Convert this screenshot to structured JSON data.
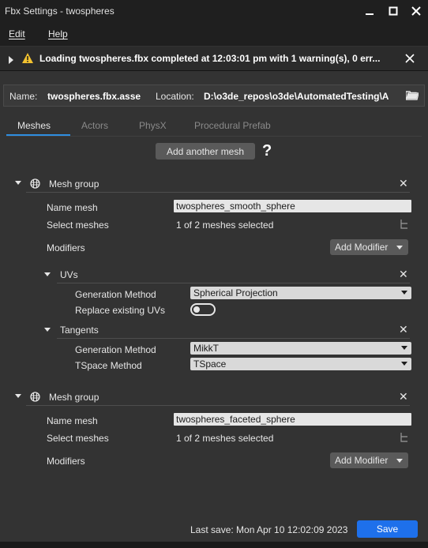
{
  "window": {
    "title": "Fbx Settings - twospheres"
  },
  "menu": {
    "edit": "Edit",
    "help": "Help"
  },
  "notification": {
    "text": "Loading twospheres.fbx completed at 12:03:01 pm with 1 warning(s), 0 err..."
  },
  "file": {
    "name_label": "Name:",
    "name_value": "twospheres.fbx.asse",
    "location_label": "Location:",
    "location_value": "D:\\o3de_repos\\o3de\\AutomatedTesting\\A"
  },
  "tabs": [
    {
      "label": "Meshes"
    },
    {
      "label": "Actors"
    },
    {
      "label": "PhysX"
    },
    {
      "label": "Procedural Prefab"
    }
  ],
  "add_mesh_button": "Add another mesh",
  "help_glyph": "?",
  "mesh_groups": [
    {
      "header": "Mesh group",
      "name_label": "Name mesh",
      "name_value": "twospheres_smooth_sphere",
      "select_label": "Select meshes",
      "select_value": "1 of 2 meshes selected",
      "modifiers_label": "Modifiers",
      "add_modifier": "Add Modifier",
      "uvs": {
        "header": "UVs",
        "gen_label": "Generation Method",
        "gen_value": "Spherical Projection",
        "replace_label": "Replace existing UVs",
        "replace_on": false
      },
      "tangents": {
        "header": "Tangents",
        "gen_label": "Generation Method",
        "gen_value": "MikkT",
        "tspace_label": "TSpace Method",
        "tspace_value": "TSpace"
      }
    },
    {
      "header": "Mesh group",
      "name_label": "Name mesh",
      "name_value": "twospheres_faceted_sphere",
      "select_label": "Select meshes",
      "select_value": "1 of 2 meshes selected",
      "modifiers_label": "Modifiers",
      "add_modifier": "Add Modifier"
    }
  ],
  "footer": {
    "last_save": "Last save:  Mon Apr 10 12:02:09 2023",
    "save_button": "Save"
  },
  "colors": {
    "accent": "#2e8ee0",
    "save": "#1e70eb",
    "warning": "#f2c230"
  }
}
